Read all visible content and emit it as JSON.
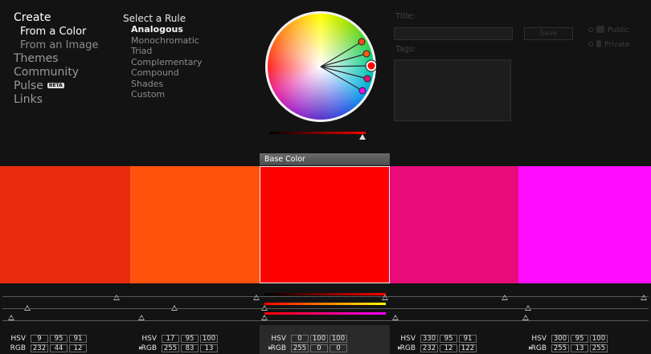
{
  "nav": {
    "create": "Create",
    "from_color": "From a Color",
    "from_image": "From an Image",
    "themes": "Themes",
    "community": "Community",
    "pulse": "Pulse",
    "pulse_badge": "BETA",
    "links": "Links"
  },
  "rules": {
    "title": "Select a Rule",
    "items": [
      {
        "label": "Analogous",
        "active": true
      },
      {
        "label": "Monochromatic"
      },
      {
        "label": "Triad"
      },
      {
        "label": "Complementary"
      },
      {
        "label": "Compound"
      },
      {
        "label": "Shades"
      },
      {
        "label": "Custom"
      }
    ]
  },
  "form": {
    "title_label": "Title:",
    "tags_label": "Tags:",
    "save_label": "Save",
    "public_label": "Public",
    "private_label": "Private"
  },
  "base_color_tab": "Base Color",
  "accent_colors": {
    "wheel_marker_stroke": "#ffffff",
    "wheel_lines": "#2a2a2a"
  },
  "swatches": [
    {
      "hex": "#E82C0C",
      "hsv": [
        "9",
        "95",
        "91"
      ],
      "rgb": [
        "232",
        "44",
        "12"
      ]
    },
    {
      "hex": "#FF530D",
      "hsv": [
        "17",
        "95",
        "100"
      ],
      "rgb": [
        "255",
        "83",
        "13"
      ]
    },
    {
      "hex": "#FF0000",
      "hsv": [
        "0",
        "100",
        "100"
      ],
      "rgb": [
        "255",
        "0",
        "0"
      ],
      "base": true
    },
    {
      "hex": "#E80C7A",
      "hsv": [
        "330",
        "95",
        "91"
      ],
      "rgb": [
        "232",
        "12",
        "122"
      ]
    },
    {
      "hex": "#FF0DFF",
      "hsv": [
        "300",
        "95",
        "100"
      ],
      "rgb": [
        "255",
        "13",
        "255"
      ]
    }
  ],
  "labels": {
    "hsv": "HSV",
    "rgb": "RGB"
  }
}
